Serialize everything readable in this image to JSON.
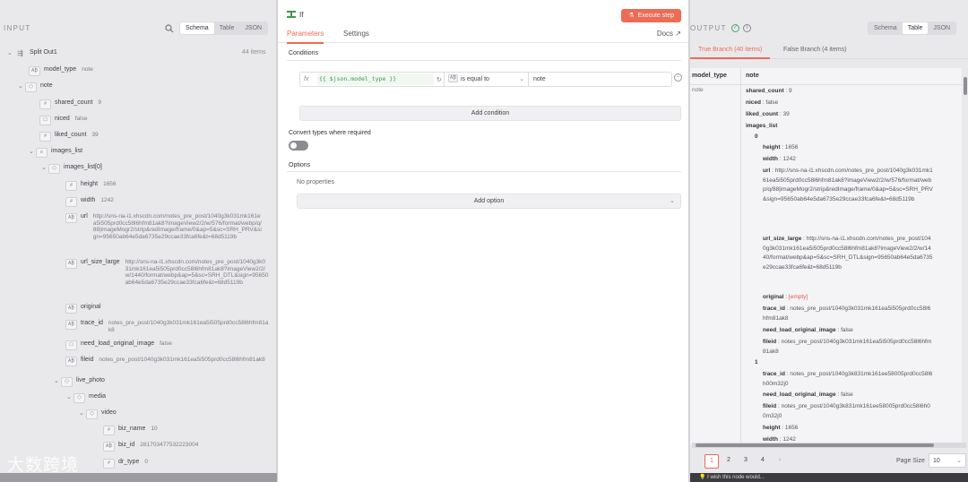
{
  "input": {
    "title": "INPUT",
    "view_tabs": [
      "Schema",
      "Table",
      "JSON"
    ],
    "active_tab": "Schema",
    "node_name": "Split Out1",
    "items_count": "44 items",
    "fields": {
      "model_type": {
        "key": "model_type",
        "value": "note"
      },
      "note": {
        "key": "note"
      },
      "shared_count": {
        "key": "shared_count",
        "value": "9"
      },
      "niced": {
        "key": "niced",
        "value": "false"
      },
      "liked_count": {
        "key": "liked_count",
        "value": "39"
      },
      "images_list": {
        "key": "images_list"
      },
      "images_list_0": {
        "key": "images_list[0]"
      },
      "height": {
        "key": "height",
        "value": "1656"
      },
      "width": {
        "key": "width",
        "value": "1242"
      },
      "url": {
        "key": "url",
        "value": "http://sns-na-i1.xhscdn.com/notes_pre_post/1040g3k031mk161ea5i505prd0cc58l6hfm81ak8?imageView2/2/w/576/format/webp/q/88|imageMogr2/strip&redImage/frame/0&ap=5&sc=SRH_PRV&sign=95650ab64e5da6735e29ccae33fca6fe&t=68d5119b"
      },
      "url_size_large": {
        "key": "url_size_large",
        "value": "http://sns-na-i1.xhscdn.com/notes_pre_post/1040g3k031mk161ea5i505prd0cc58l6hfm81ak8?imageView2/2/w/1440/format/webp&ap=5&sc=SRH_DTL&sign=95650ab64e5da6735e29ccae33fca6fe&t=68d5119b"
      },
      "original": {
        "key": "original"
      },
      "trace_id": {
        "key": "trace_id",
        "value": "notes_pre_post/1040g3k031mk161ea5i505prd0cc58l6hfm81ak8"
      },
      "need_load_original_image": {
        "key": "need_load_original_image",
        "value": "false"
      },
      "fileid": {
        "key": "fileid",
        "value": "notes_pre_post/1040g3k031mk161ea5i505prd0cc58l6hfm81ak8"
      },
      "live_photo": {
        "key": "live_photo"
      },
      "media": {
        "key": "media"
      },
      "video": {
        "key": "video"
      },
      "biz_name": {
        "key": "biz_name",
        "value": "10"
      },
      "biz_id": {
        "key": "biz_id",
        "value": "281703477532223004"
      },
      "dr_type": {
        "key": "dr_type",
        "value": "0"
      }
    }
  },
  "modal": {
    "node_title": "If",
    "execute_label": "Execute step",
    "tabs": [
      "Parameters",
      "Settings"
    ],
    "docs_label": "Docs",
    "conditions_title": "Conditions",
    "condition": {
      "left_value": "{{ $json.model_type }}",
      "operator": "is equal to",
      "right_value": "note"
    },
    "add_condition_label": "Add condition",
    "convert_types_label": "Convert types where required",
    "options_title": "Options",
    "no_properties": "No properties",
    "add_option_label": "Add option"
  },
  "output": {
    "title": "OUTPUT",
    "view_tabs": [
      "Schema",
      "Table",
      "JSON"
    ],
    "active_tab": "Table",
    "branch_tabs": [
      "True Branch (40 items)",
      "False Branch (4 items)"
    ],
    "columns": [
      "model_type",
      "note"
    ],
    "row_model_type": "note",
    "lines": {
      "shared_count": {
        "k": "shared_count",
        "v": "9"
      },
      "niced": {
        "k": "niced",
        "v": "false"
      },
      "liked_count": {
        "k": "liked_count",
        "v": "39"
      },
      "images_list": {
        "k": "images_list"
      },
      "idx0": "0",
      "h0": {
        "k": "height",
        "v": "1656"
      },
      "w0": {
        "k": "width",
        "v": "1242"
      },
      "url0": {
        "k": "url",
        "v": "http://sns-na-i1.xhscdn.com/notes_pre_post/1040g3k031mk161ea5i505prd0cc58l6hfm81ak8?imageView2/2/w/576/format/webp/q/88|imageMogr2/strip&redImage/frame/0&ap=5&sc=SRH_PRV&sign=95650ab64e5da6735e29ccae33fca6fe&t=68d5119b"
      },
      "usl0": {
        "k": "url_size_large",
        "v": "http://sns-na-i1.xhscdn.com/notes_pre_post/1040g3k031mk161ea5i505prd0cc58l6hfm81ak8?imageView2/2/w/1440/format/webp&ap=5&sc=SRH_DTL&sign=95650ab64e5da6735e29ccae33fca6fe&t=68d5119b"
      },
      "orig0": {
        "k": "original",
        "v": "[empty]"
      },
      "trace0": {
        "k": "trace_id",
        "v": "notes_pre_post/1040g3k031mk161ea5i505prd0cc58l6hfm81ak8"
      },
      "nloi0": {
        "k": "need_load_original_image",
        "v": "false"
      },
      "file0": {
        "k": "fileid",
        "v": "notes_pre_post/1040g3k031mk161ea5i505prd0cc58l6hfm81ak8"
      },
      "idx1": "1",
      "trace1": {
        "k": "trace_id",
        "v": "notes_pre_post/1040g3k831mk161ee58005prd0cc58l6h00m32j0"
      },
      "nloi1": {
        "k": "need_load_original_image",
        "v": "false"
      },
      "file1": {
        "k": "fileid",
        "v": "notes_pre_post/1040g3k831mk161ee58005prd0cc58l6h00m32j0"
      },
      "h1": {
        "k": "height",
        "v": "1656"
      },
      "w1": {
        "k": "width",
        "v": "1242"
      }
    },
    "pages": [
      "1",
      "2",
      "3",
      "4"
    ],
    "active_page": "1",
    "page_size_label": "Page Size",
    "page_size": "10",
    "chat_hint": "I wish this node would..."
  },
  "watermark": "大数跨境",
  "colors": {
    "accent": "#ee6b55",
    "success": "#4aa36a",
    "expr_green": "#3c9b4a"
  }
}
